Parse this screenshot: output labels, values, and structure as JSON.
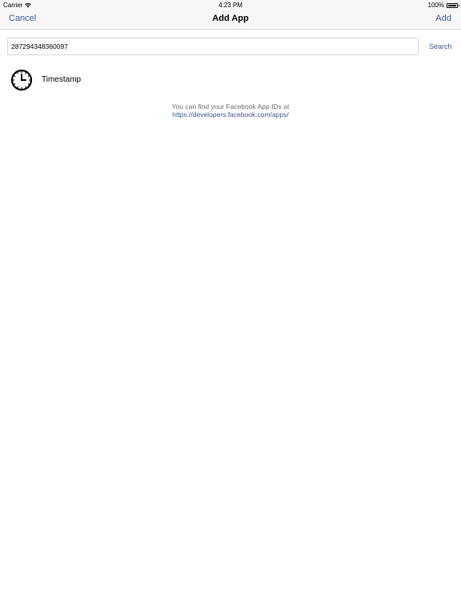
{
  "status_bar": {
    "carrier": "Carrier",
    "time": "4:23 PM",
    "battery": "100%",
    "battery_level": 1.0
  },
  "nav": {
    "cancel_label": "Cancel",
    "title": "Add App",
    "add_label": "Add"
  },
  "search": {
    "value": "287294348360097",
    "button_label": "Search"
  },
  "results": [
    {
      "icon": "clock-icon",
      "label": "Timestamp"
    }
  ],
  "hint": {
    "text": "You can find your Facebook App IDs at",
    "link": "https://developers.facebook.com/apps/"
  },
  "colors": {
    "accent": "#3b5998",
    "bar_background": "#f7f7f7",
    "hint_text": "#6d6d72"
  }
}
